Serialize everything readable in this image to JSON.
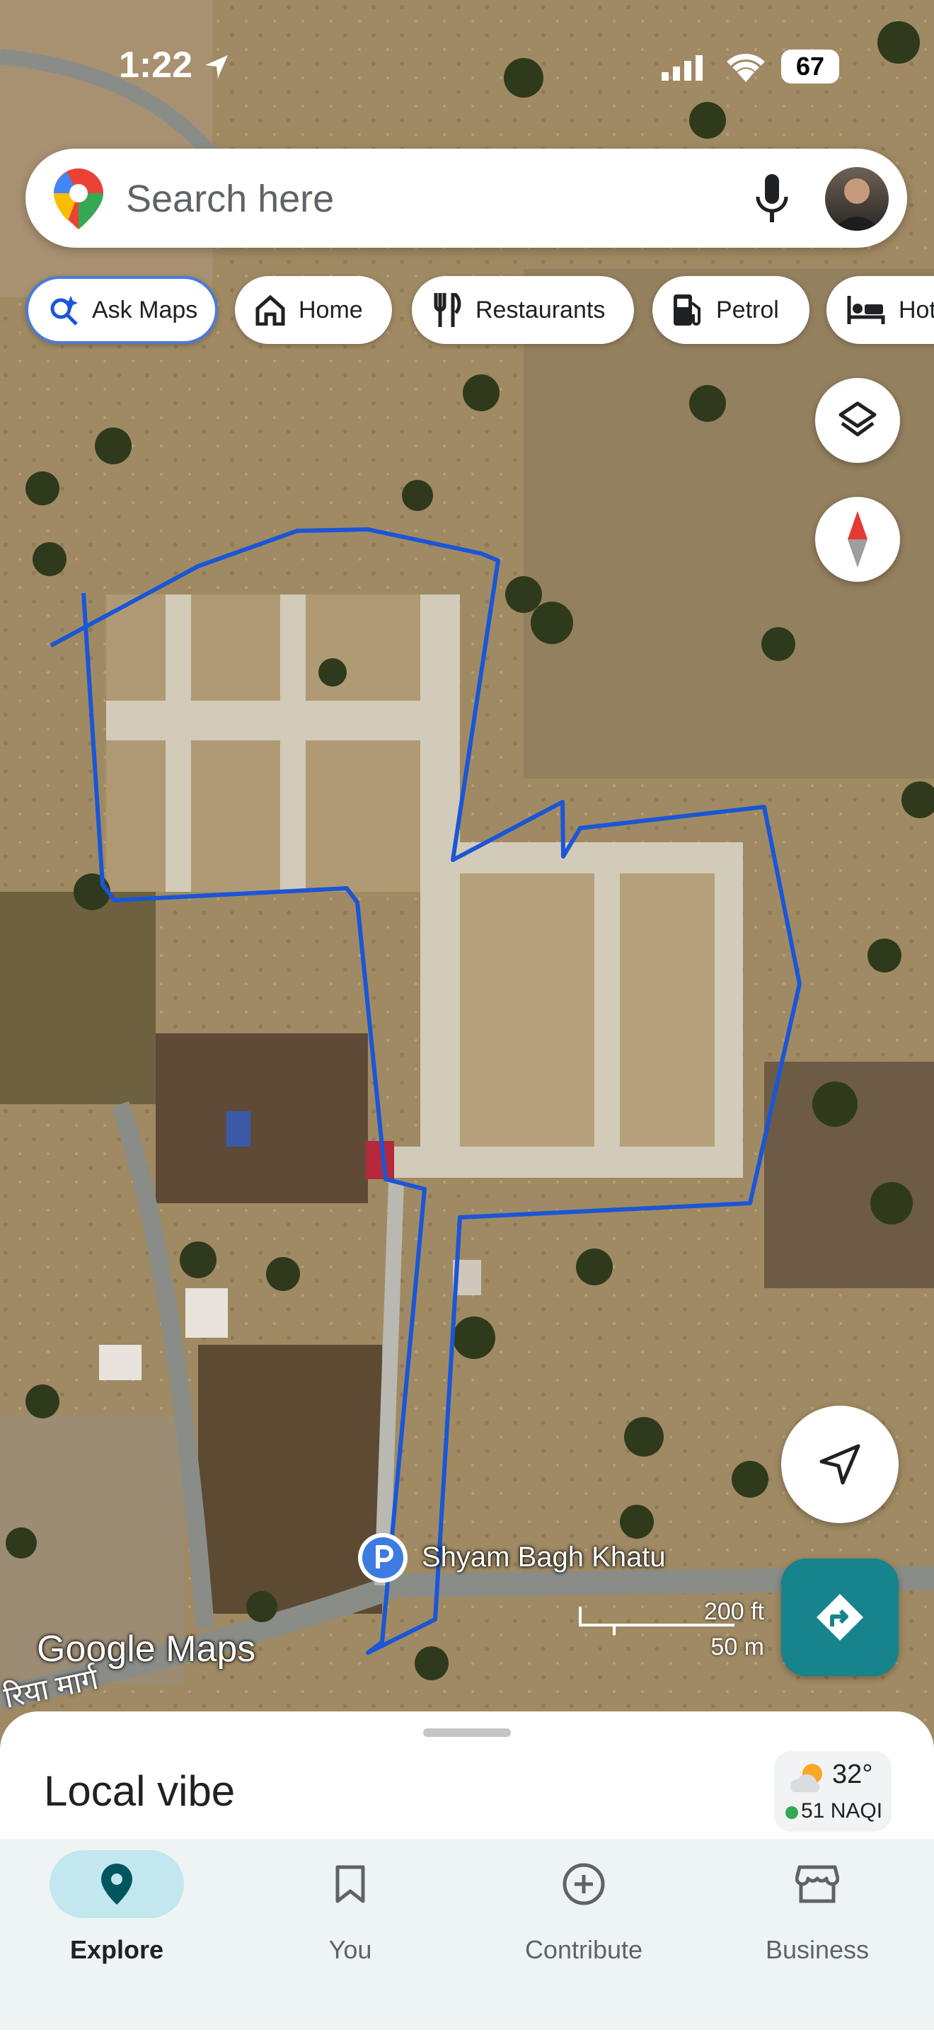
{
  "status_bar": {
    "time": "1:22",
    "battery": "67"
  },
  "search": {
    "placeholder": "Search here"
  },
  "chips": [
    {
      "label": "Ask Maps",
      "icon": "sparkle-search-icon"
    },
    {
      "label": "Home",
      "icon": "home-icon"
    },
    {
      "label": "Restaurants",
      "icon": "restaurant-icon"
    },
    {
      "label": "Petrol",
      "icon": "fuel-icon"
    },
    {
      "label": "Hot",
      "icon": "hotel-icon"
    }
  ],
  "map": {
    "place_label": "Shyam Bagh Khatu",
    "road_label": "रिया मार्ग",
    "scale_ft": "200 ft",
    "scale_m": "50 m",
    "logo": "Google Maps"
  },
  "sheet": {
    "title": "Local vibe",
    "weather": {
      "temp": "32°",
      "aqi": "51 NAQI"
    }
  },
  "nav": [
    {
      "label": "Explore",
      "icon": "pin-icon",
      "active": true
    },
    {
      "label": "You",
      "icon": "bookmark-icon",
      "active": false
    },
    {
      "label": "Contribute",
      "icon": "add-circle-icon",
      "active": false
    },
    {
      "label": "Business",
      "icon": "storefront-icon",
      "active": false
    }
  ],
  "colors": {
    "route": "#1a56d6",
    "accent": "#17838c",
    "active_nav": "#c2e7ee"
  }
}
